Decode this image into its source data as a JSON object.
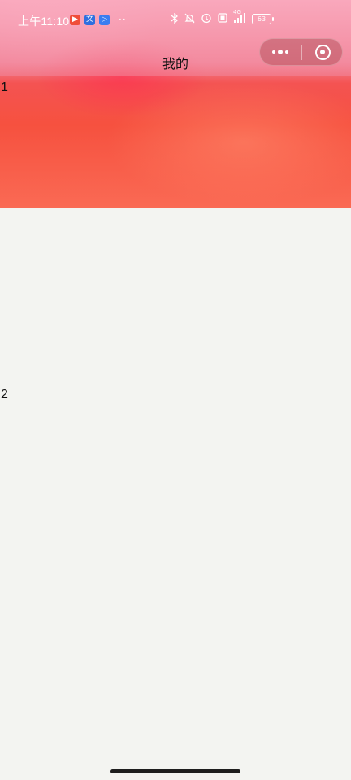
{
  "status_bar": {
    "time": "上午11:10",
    "left_app_icons": [
      {
        "name": "video-app-icon",
        "glyph": "▶",
        "color": "#f04e3a"
      },
      {
        "name": "translate-app-icon",
        "glyph": "文",
        "color": "#2f6fdf"
      },
      {
        "name": "play-app-icon",
        "glyph": "▷",
        "color": "#3b7df0"
      }
    ],
    "more_dots": "··",
    "right_icons": [
      "bluetooth-icon",
      "bell-icon",
      "alarm-icon",
      "hd-icon",
      "signal-icon"
    ],
    "network_label": "4G",
    "battery_level": "63"
  },
  "nav": {
    "title": "我的"
  },
  "content": {
    "marker_1": "1",
    "marker_2": "2"
  },
  "colors": {
    "hero_top": "#f59bb1",
    "hero_bottom": "#fa6a54",
    "page_background": "#f3f4f1"
  }
}
